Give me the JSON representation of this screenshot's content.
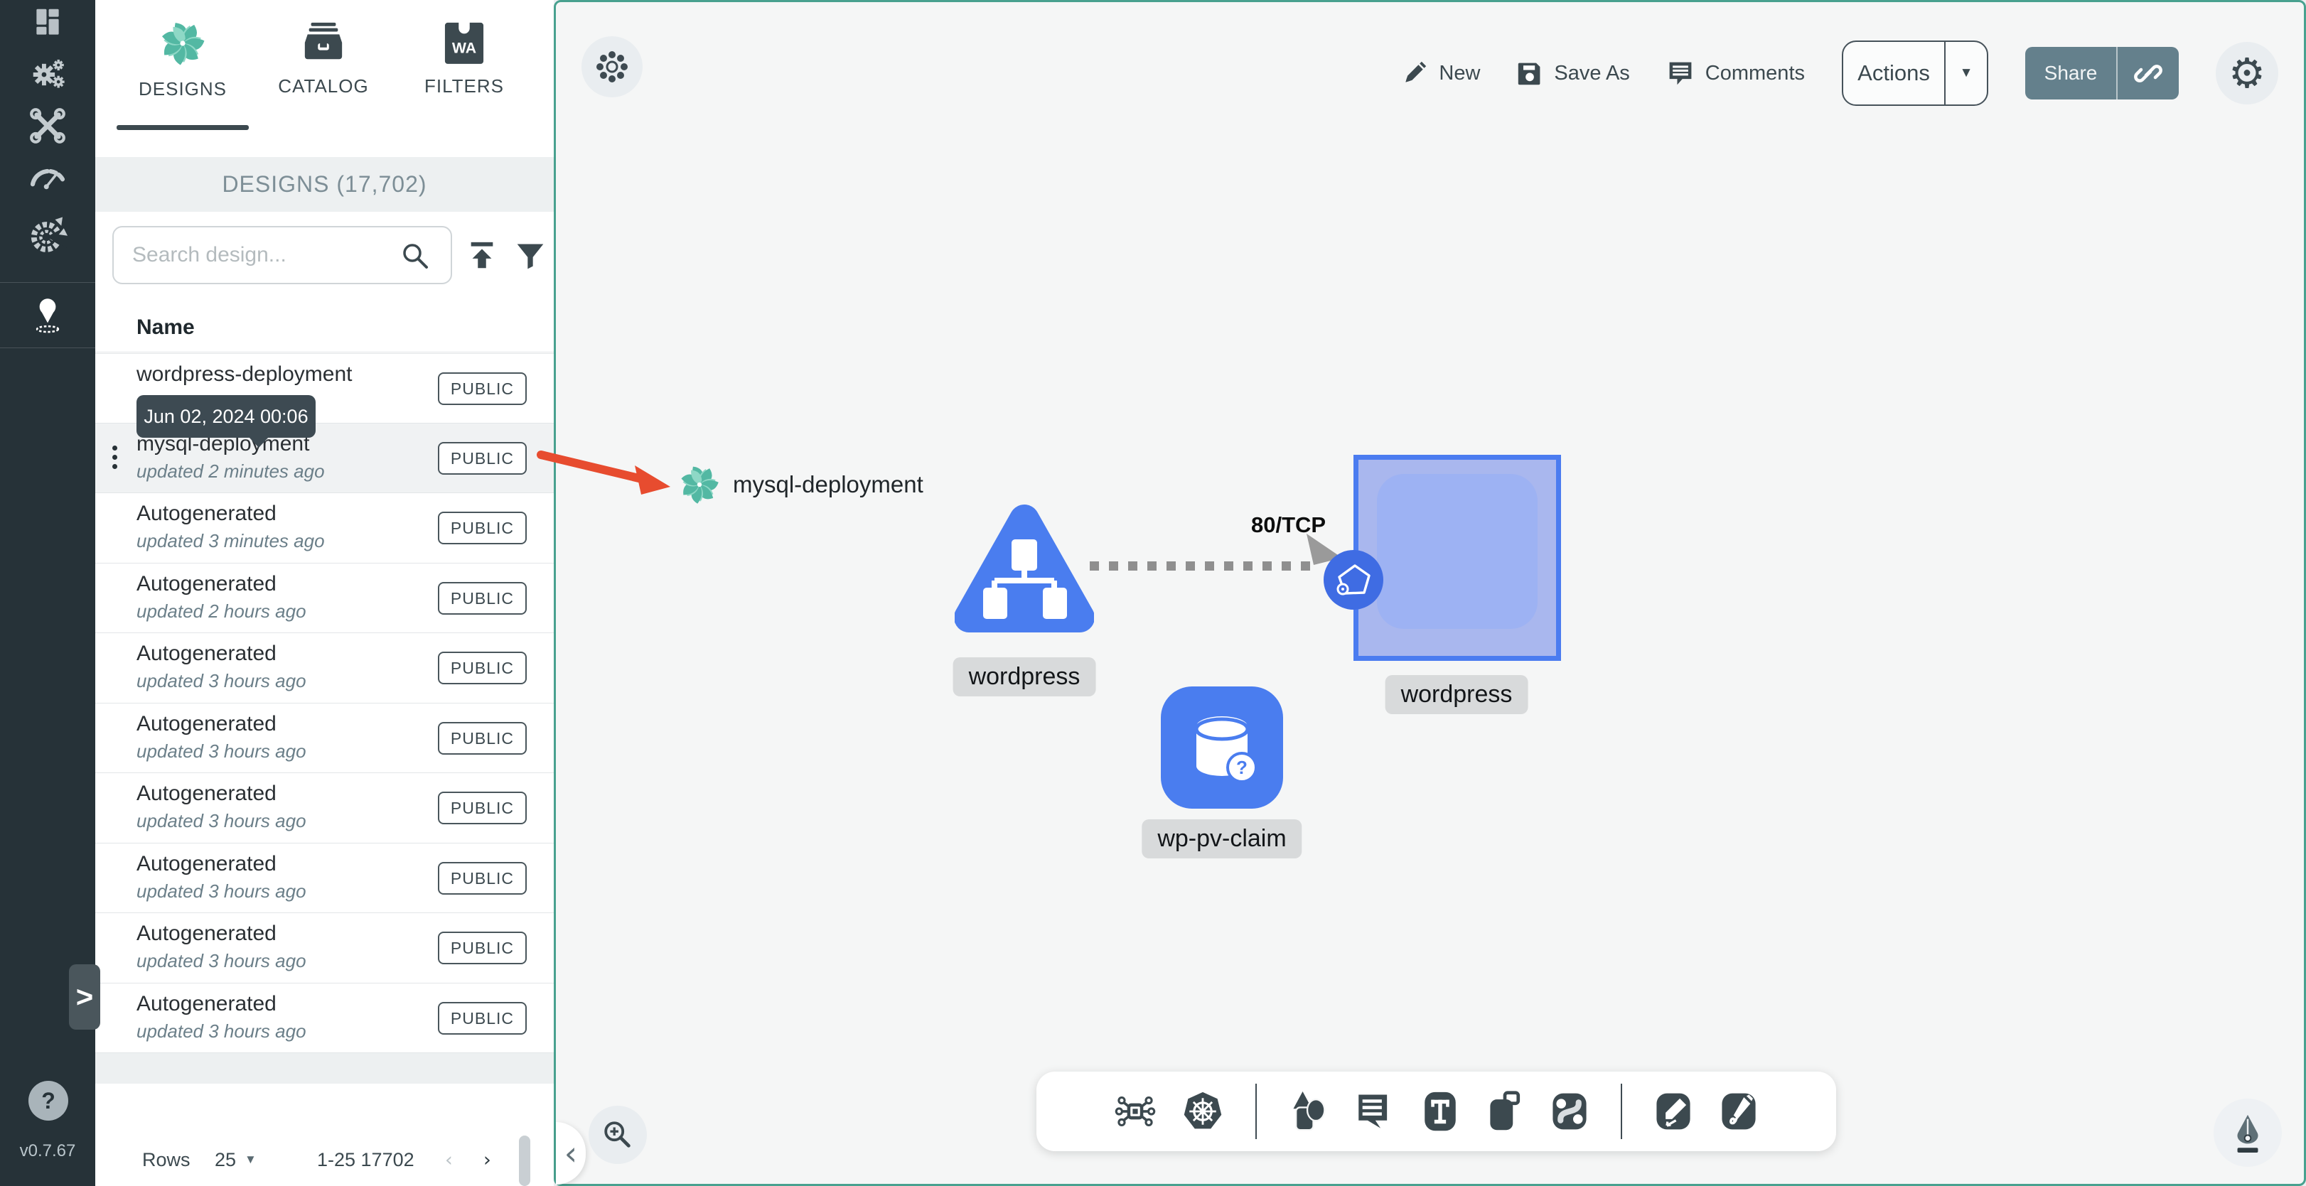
{
  "colors": {
    "sidebar_bg": "#263238",
    "canvas_border_teal": "#48a18f",
    "node_blue": "#4a7def",
    "selection_blue": "#4b7cf0",
    "share_button_bg": "#64808c",
    "drag_arrow_red": "#e74c2f",
    "tooltip_bg": "#3d4a52",
    "header_band_bg": "#edf0f1"
  },
  "app": {
    "version": "v0.7.67",
    "help_glyph": "?",
    "expand_glyph": ">"
  },
  "sidebar": {
    "icons": [
      "dashboard",
      "lifecycle",
      "configuration",
      "performance",
      "extensions",
      "kanvas"
    ]
  },
  "panel": {
    "tabs": [
      {
        "label": "DESIGNS",
        "active": true
      },
      {
        "label": "CATALOG",
        "active": false
      },
      {
        "label": "FILTERS",
        "active": false
      }
    ],
    "count_header": "DESIGNS (17,702)",
    "search": {
      "placeholder": "Search design..."
    },
    "table": {
      "name_header": "Name"
    },
    "rows": [
      {
        "name": "wordpress-deployment",
        "updated": "",
        "badge": "PUBLIC",
        "hovered": false
      },
      {
        "name": "mysql-deployment",
        "updated": "updated 2 minutes ago",
        "badge": "PUBLIC",
        "hovered": true
      },
      {
        "name": "Autogenerated",
        "updated": "updated 3 minutes ago",
        "badge": "PUBLIC",
        "hovered": false
      },
      {
        "name": "Autogenerated",
        "updated": "updated 2 hours ago",
        "badge": "PUBLIC",
        "hovered": false
      },
      {
        "name": "Autogenerated",
        "updated": "updated 3 hours ago",
        "badge": "PUBLIC",
        "hovered": false
      },
      {
        "name": "Autogenerated",
        "updated": "updated 3 hours ago",
        "badge": "PUBLIC",
        "hovered": false
      },
      {
        "name": "Autogenerated",
        "updated": "updated 3 hours ago",
        "badge": "PUBLIC",
        "hovered": false
      },
      {
        "name": "Autogenerated",
        "updated": "updated 3 hours ago",
        "badge": "PUBLIC",
        "hovered": false
      },
      {
        "name": "Autogenerated",
        "updated": "updated 3 hours ago",
        "badge": "PUBLIC",
        "hovered": false
      },
      {
        "name": "Autogenerated",
        "updated": "updated 3 hours ago",
        "badge": "PUBLIC",
        "hovered": false
      }
    ],
    "tooltip": "Jun 02, 2024 00:06",
    "pagination": {
      "rows_label": "Rows",
      "per_page": "25",
      "caret": "▼",
      "range": "1-25 17702",
      "prev": "‹",
      "next": "›"
    }
  },
  "canvas": {
    "top_toolbar": {
      "new": "New",
      "save_as": "Save As",
      "comments": "Comments",
      "actions": "Actions",
      "actions_caret": "▼",
      "share": "Share",
      "gear_glyph": "⚙"
    },
    "drag_ghost_label": "mysql-deployment",
    "edge": {
      "label": "80/TCP"
    },
    "nodes": [
      {
        "label": "wordpress",
        "type": "service-triangle"
      },
      {
        "label": "wordpress",
        "type": "deployment-selected"
      },
      {
        "label": "wp-pv-claim",
        "type": "persistent-volume-claim",
        "badge": "?"
      }
    ],
    "bottom_toolbar_icons": [
      "components",
      "kubernetes",
      "shapes",
      "comment",
      "text",
      "clone",
      "relationship",
      "edit-pen",
      "draw-pencil"
    ],
    "drawer_collapse_glyph": "‹"
  }
}
